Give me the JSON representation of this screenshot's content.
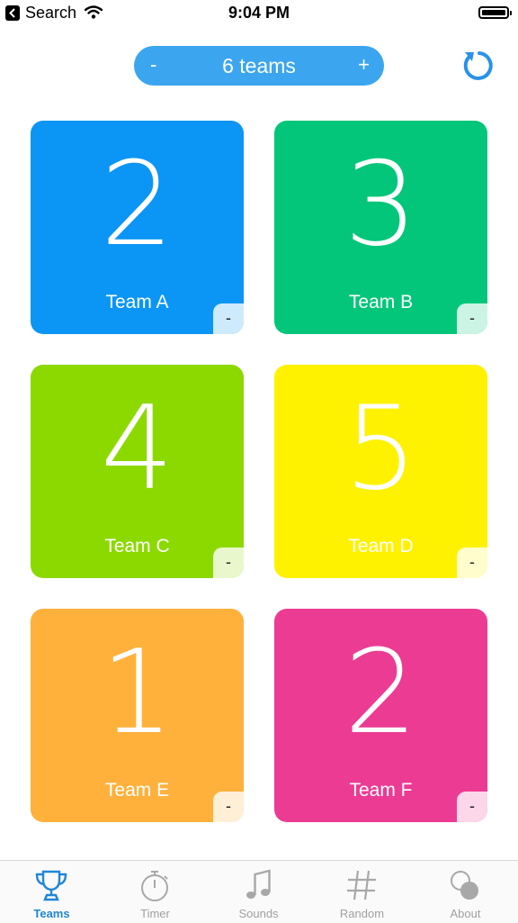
{
  "status_bar": {
    "back_label": "Search",
    "time": "9:04 PM"
  },
  "header": {
    "decrease_label": "-",
    "team_count": "6 teams",
    "increase_label": "+",
    "reset_icon": "refresh-icon"
  },
  "teams": [
    {
      "name": "Team A",
      "score": "2",
      "color": "#0b95f5",
      "decrease_label": "-"
    },
    {
      "name": "Team B",
      "score": "3",
      "color": "#04c67a",
      "decrease_label": "-"
    },
    {
      "name": "Team C",
      "score": "4",
      "color": "#8cd900",
      "decrease_label": "-"
    },
    {
      "name": "Team D",
      "score": "5",
      "color": "#fef200",
      "decrease_label": "-"
    },
    {
      "name": "Team E",
      "score": "1",
      "color": "#ffb13b",
      "decrease_label": "-"
    },
    {
      "name": "Team F",
      "score": "2",
      "color": "#ec3b93",
      "decrease_label": "-"
    }
  ],
  "tabbar": {
    "active_color": "#1f86d8",
    "items": [
      {
        "label": "Teams",
        "icon": "trophy-icon"
      },
      {
        "label": "Timer",
        "icon": "stopwatch-icon"
      },
      {
        "label": "Sounds",
        "icon": "music-notes-icon"
      },
      {
        "label": "Random",
        "icon": "hash-icon"
      },
      {
        "label": "About",
        "icon": "about-circles-icon"
      }
    ]
  }
}
